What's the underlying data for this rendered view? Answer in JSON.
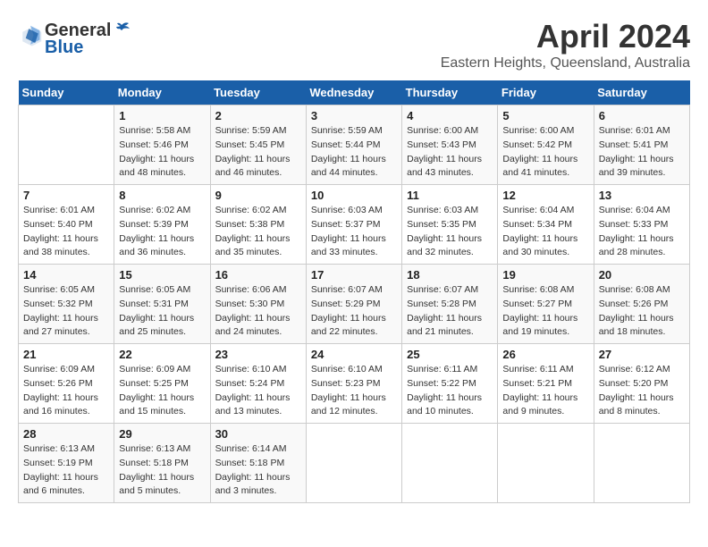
{
  "header": {
    "logo_line1": "General",
    "logo_line2": "Blue",
    "title": "April 2024",
    "subtitle": "Eastern Heights, Queensland, Australia"
  },
  "days_of_week": [
    "Sunday",
    "Monday",
    "Tuesday",
    "Wednesday",
    "Thursday",
    "Friday",
    "Saturday"
  ],
  "weeks": [
    [
      {
        "day": "",
        "info": ""
      },
      {
        "day": "1",
        "info": "Sunrise: 5:58 AM\nSunset: 5:46 PM\nDaylight: 11 hours\nand 48 minutes."
      },
      {
        "day": "2",
        "info": "Sunrise: 5:59 AM\nSunset: 5:45 PM\nDaylight: 11 hours\nand 46 minutes."
      },
      {
        "day": "3",
        "info": "Sunrise: 5:59 AM\nSunset: 5:44 PM\nDaylight: 11 hours\nand 44 minutes."
      },
      {
        "day": "4",
        "info": "Sunrise: 6:00 AM\nSunset: 5:43 PM\nDaylight: 11 hours\nand 43 minutes."
      },
      {
        "day": "5",
        "info": "Sunrise: 6:00 AM\nSunset: 5:42 PM\nDaylight: 11 hours\nand 41 minutes."
      },
      {
        "day": "6",
        "info": "Sunrise: 6:01 AM\nSunset: 5:41 PM\nDaylight: 11 hours\nand 39 minutes."
      }
    ],
    [
      {
        "day": "7",
        "info": "Sunrise: 6:01 AM\nSunset: 5:40 PM\nDaylight: 11 hours\nand 38 minutes."
      },
      {
        "day": "8",
        "info": "Sunrise: 6:02 AM\nSunset: 5:39 PM\nDaylight: 11 hours\nand 36 minutes."
      },
      {
        "day": "9",
        "info": "Sunrise: 6:02 AM\nSunset: 5:38 PM\nDaylight: 11 hours\nand 35 minutes."
      },
      {
        "day": "10",
        "info": "Sunrise: 6:03 AM\nSunset: 5:37 PM\nDaylight: 11 hours\nand 33 minutes."
      },
      {
        "day": "11",
        "info": "Sunrise: 6:03 AM\nSunset: 5:35 PM\nDaylight: 11 hours\nand 32 minutes."
      },
      {
        "day": "12",
        "info": "Sunrise: 6:04 AM\nSunset: 5:34 PM\nDaylight: 11 hours\nand 30 minutes."
      },
      {
        "day": "13",
        "info": "Sunrise: 6:04 AM\nSunset: 5:33 PM\nDaylight: 11 hours\nand 28 minutes."
      }
    ],
    [
      {
        "day": "14",
        "info": "Sunrise: 6:05 AM\nSunset: 5:32 PM\nDaylight: 11 hours\nand 27 minutes."
      },
      {
        "day": "15",
        "info": "Sunrise: 6:05 AM\nSunset: 5:31 PM\nDaylight: 11 hours\nand 25 minutes."
      },
      {
        "day": "16",
        "info": "Sunrise: 6:06 AM\nSunset: 5:30 PM\nDaylight: 11 hours\nand 24 minutes."
      },
      {
        "day": "17",
        "info": "Sunrise: 6:07 AM\nSunset: 5:29 PM\nDaylight: 11 hours\nand 22 minutes."
      },
      {
        "day": "18",
        "info": "Sunrise: 6:07 AM\nSunset: 5:28 PM\nDaylight: 11 hours\nand 21 minutes."
      },
      {
        "day": "19",
        "info": "Sunrise: 6:08 AM\nSunset: 5:27 PM\nDaylight: 11 hours\nand 19 minutes."
      },
      {
        "day": "20",
        "info": "Sunrise: 6:08 AM\nSunset: 5:26 PM\nDaylight: 11 hours\nand 18 minutes."
      }
    ],
    [
      {
        "day": "21",
        "info": "Sunrise: 6:09 AM\nSunset: 5:26 PM\nDaylight: 11 hours\nand 16 minutes."
      },
      {
        "day": "22",
        "info": "Sunrise: 6:09 AM\nSunset: 5:25 PM\nDaylight: 11 hours\nand 15 minutes."
      },
      {
        "day": "23",
        "info": "Sunrise: 6:10 AM\nSunset: 5:24 PM\nDaylight: 11 hours\nand 13 minutes."
      },
      {
        "day": "24",
        "info": "Sunrise: 6:10 AM\nSunset: 5:23 PM\nDaylight: 11 hours\nand 12 minutes."
      },
      {
        "day": "25",
        "info": "Sunrise: 6:11 AM\nSunset: 5:22 PM\nDaylight: 11 hours\nand 10 minutes."
      },
      {
        "day": "26",
        "info": "Sunrise: 6:11 AM\nSunset: 5:21 PM\nDaylight: 11 hours\nand 9 minutes."
      },
      {
        "day": "27",
        "info": "Sunrise: 6:12 AM\nSunset: 5:20 PM\nDaylight: 11 hours\nand 8 minutes."
      }
    ],
    [
      {
        "day": "28",
        "info": "Sunrise: 6:13 AM\nSunset: 5:19 PM\nDaylight: 11 hours\nand 6 minutes."
      },
      {
        "day": "29",
        "info": "Sunrise: 6:13 AM\nSunset: 5:18 PM\nDaylight: 11 hours\nand 5 minutes."
      },
      {
        "day": "30",
        "info": "Sunrise: 6:14 AM\nSunset: 5:18 PM\nDaylight: 11 hours\nand 3 minutes."
      },
      {
        "day": "",
        "info": ""
      },
      {
        "day": "",
        "info": ""
      },
      {
        "day": "",
        "info": ""
      },
      {
        "day": "",
        "info": ""
      }
    ]
  ]
}
